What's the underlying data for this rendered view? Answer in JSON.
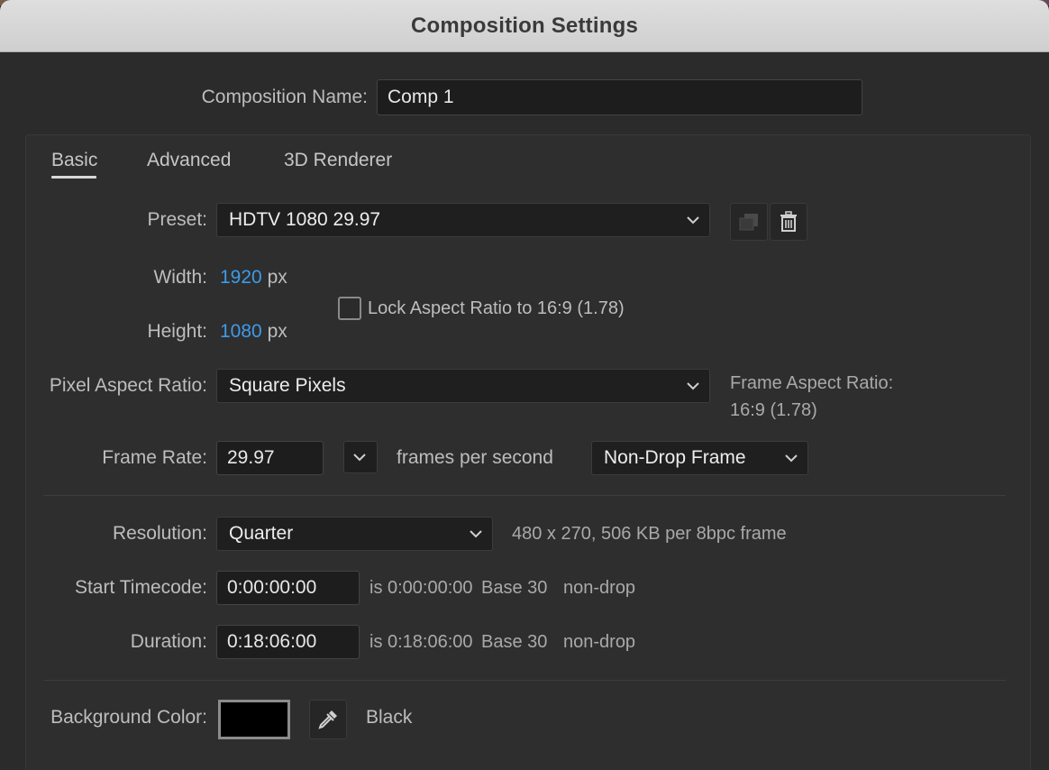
{
  "window": {
    "title": "Composition Settings"
  },
  "composition_name": {
    "label": "Composition Name:",
    "value": "Comp 1"
  },
  "tabs": [
    {
      "label": "Basic",
      "active": true
    },
    {
      "label": "Advanced",
      "active": false
    },
    {
      "label": "3D Renderer",
      "active": false
    }
  ],
  "preset": {
    "label": "Preset:",
    "value": "HDTV 1080 29.97",
    "save_icon": "save-preset-icon",
    "delete_icon": "trash-icon"
  },
  "width": {
    "label": "Width:",
    "value": "1920",
    "unit": "px"
  },
  "height": {
    "label": "Height:",
    "value": "1080",
    "unit": "px"
  },
  "lock_aspect": {
    "label": "Lock Aspect Ratio to 16:9 (1.78)",
    "checked": false
  },
  "pixel_aspect": {
    "label": "Pixel Aspect Ratio:",
    "value": "Square Pixels"
  },
  "frame_aspect": {
    "label": "Frame Aspect Ratio:",
    "value": "16:9 (1.78)"
  },
  "frame_rate": {
    "label": "Frame Rate:",
    "value": "29.97",
    "unit_label": "frames per second",
    "drop_mode": "Non-Drop Frame"
  },
  "resolution": {
    "label": "Resolution:",
    "value": "Quarter",
    "info": "480 x 270, 506 KB per 8bpc frame"
  },
  "start_timecode": {
    "label": "Start Timecode:",
    "value": "0:00:00:00",
    "is_text": "is 0:00:00:00",
    "base": "Base 30",
    "mode": "non-drop"
  },
  "duration": {
    "label": "Duration:",
    "value": "0:18:06:00",
    "is_text": "is 0:18:06:00",
    "base": "Base 30",
    "mode": "non-drop"
  },
  "background_color": {
    "label": "Background Color:",
    "color": "#000000",
    "name": "Black"
  },
  "colors": {
    "accent_blue": "#3d9be9",
    "dialog_bg": "#2b2b2b"
  }
}
